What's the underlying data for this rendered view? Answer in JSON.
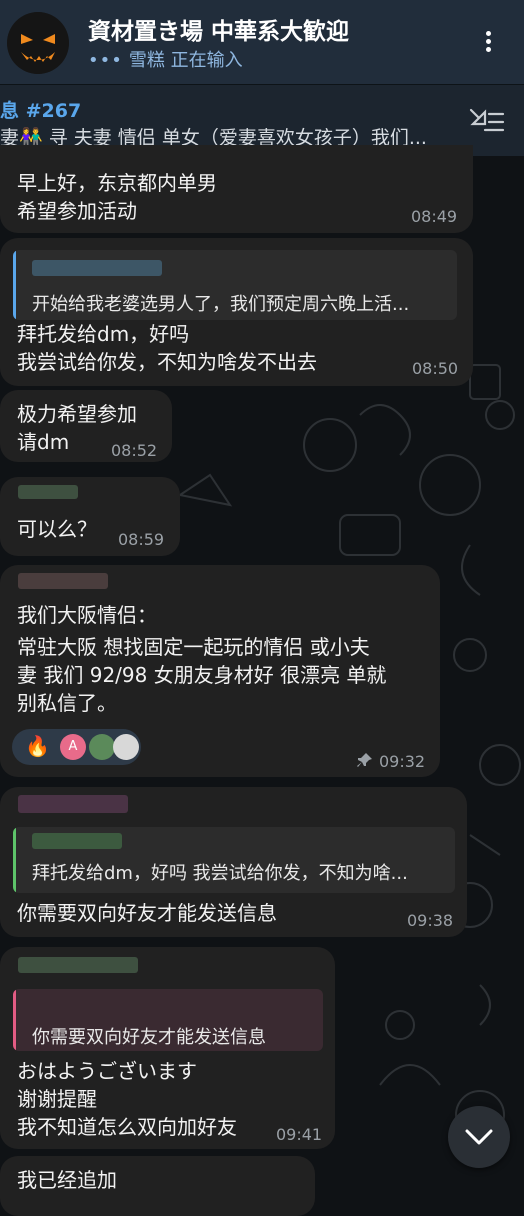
{
  "header": {
    "title": "資材置き場 中華系大歓迎",
    "status_dots": "•••",
    "status_text": "雪糕 正在输入"
  },
  "pinned": {
    "title": "息 #267",
    "text": "妻👫 寻 夫妻 情侣 单女（爱妻喜欢女孩子）我们..."
  },
  "messages": [
    {
      "lines": [
        "早上好，东京都内单男",
        "希望参加活动"
      ],
      "time": "08:49"
    },
    {
      "reply": "开始给我老婆选男人了，我们预定周六晚上活...",
      "lines": [
        "拜托发给dm，好吗",
        "我尝试给你发，不知为啥发不出去"
      ],
      "time": "08:50"
    },
    {
      "lines": [
        "极力希望参加",
        "请dm"
      ],
      "time": "08:52"
    },
    {
      "lines": [
        "可以么？"
      ],
      "time": "08:59"
    },
    {
      "lines": [
        "我们大阪情侣：",
        "常驻大阪 想找固定一起玩的情侣 或小夫",
        "妻 我们 92/98 女朋友身材好 很漂亮 单就",
        "别私信了。"
      ],
      "time": "09:32",
      "reactions": {
        "emoji": "🔥",
        "avatar_letter": "A"
      }
    },
    {
      "reply": "拜托发给dm，好吗 我尝试给你发，不知为啥...",
      "lines": [
        "你需要双向好友才能发送信息"
      ],
      "time": "09:38"
    },
    {
      "reply": "你需要双向好友才能发送信息",
      "lines": [
        "おはようございます",
        "谢谢提醒",
        "我不知道怎么双向加好友"
      ],
      "time": "09:41"
    },
    {
      "lines": [
        "我已经追加"
      ],
      "time": ""
    }
  ],
  "colors": {
    "header_bg": "#212d3b",
    "bubble_bg": "#212121",
    "accent_blue": "#5aa7ec",
    "reply_green": "#5ec46a",
    "reply_pink": "#e35c84"
  },
  "icons": [
    "more-vert-icon",
    "pin-list-icon",
    "chevron-down-icon",
    "fire-emoji",
    "pin-icon"
  ]
}
